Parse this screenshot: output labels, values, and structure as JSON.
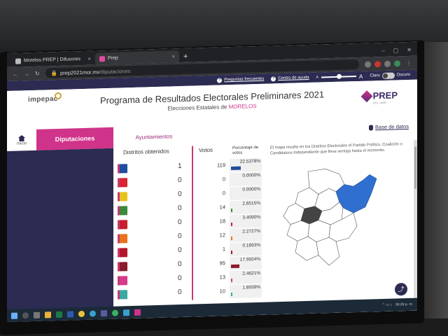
{
  "browser": {
    "tabs": [
      {
        "label": "Morelos PREP | Difusores"
      },
      {
        "label": "Prep"
      }
    ],
    "url_host": "prep2021mor.mx",
    "url_path": "/diputaciones"
  },
  "utilbar": {
    "faq": "Preguntas frecuentes",
    "help": "Centro de ayuda",
    "font_small": "A",
    "font_large": "A",
    "theme_light": "Claro",
    "theme_dark": "Oscuro"
  },
  "header": {
    "logo": "impepac",
    "title": "Programa de Resultados Electorales Preliminares 2021",
    "subtitle_prefix": "Elecciones Estatales de ",
    "subtitle_state": "MORELOS",
    "prep_logo": "PREP",
    "prep_sub": "2021 • MOR"
  },
  "nav": {
    "home": "Inicio",
    "tab_diputaciones": "Diputaciones",
    "tab_ayuntamientos": "Ayuntamientos",
    "base_datos": "Base de datos"
  },
  "table": {
    "header_distritos": "Distritos obtenidos",
    "header_votos": "Votos",
    "header_pct": "Porcentaje de votos",
    "rows": [
      {
        "color": "#1f4e9c",
        "distritos": "1",
        "votos": "119",
        "pct": "22.5378%",
        "pct_value": 22.5378
      },
      {
        "color": "#d7262e",
        "distritos": "0",
        "votos": "0",
        "pct": "0.0000%",
        "pct_value": 0
      },
      {
        "color": "#e8c21c",
        "distritos": "0",
        "votos": "0",
        "pct": "0.0000%",
        "pct_value": 0
      },
      {
        "color": "#3a8a3a",
        "distritos": "0",
        "votos": "14",
        "pct": "2.6515%",
        "pct_value": 2.6515
      },
      {
        "color": "#c8202a",
        "distritos": "0",
        "votos": "18",
        "pct": "3.4090%",
        "pct_value": 3.409
      },
      {
        "color": "#e8731c",
        "distritos": "0",
        "votos": "12",
        "pct": "2.2727%",
        "pct_value": 2.2727
      },
      {
        "color": "#b2182b",
        "distritos": "0",
        "votos": "1",
        "pct": "0.1893%",
        "pct_value": 0.1893
      },
      {
        "color": "#8b1a2a",
        "distritos": "0",
        "votos": "95",
        "pct": "17.9924%",
        "pct_value": 17.9924
      },
      {
        "color": "#d63a8a",
        "distritos": "0",
        "votos": "13",
        "pct": "2.4621%",
        "pct_value": 2.4621
      },
      {
        "color": "#3aa8a0",
        "distritos": "0",
        "votos": "10",
        "pct": "1.8939%",
        "pct_value": 1.8939
      }
    ]
  },
  "map": {
    "description": "El mapa resalta en los Distritos Electorales el Partido Político, Coalición o Candidatura Independiente que lleva ventaja hasta el momento.",
    "highlight_blue": "#2f6fd0",
    "highlight_dark": "#444444",
    "share_label": "Compartir"
  },
  "taskbar": {
    "clock": "06:28 p. m."
  }
}
